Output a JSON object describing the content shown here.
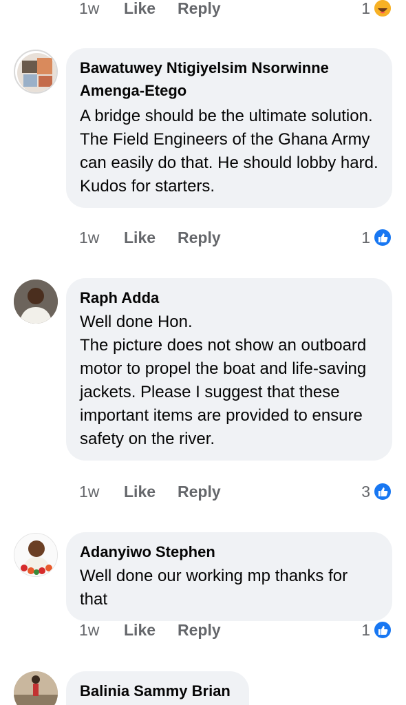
{
  "top_meta": {
    "time": "1w",
    "like": "Like",
    "reply": "Reply",
    "count": "1",
    "reaction": "haha-icon"
  },
  "comments": [
    {
      "author": "Bawatuwey Ntigiyelsim Nsorwinne Amenga-Etego",
      "text": "A bridge should be the ultimate solution. The Field Engineers of the Ghana Army can easily do that. He should lobby hard. Kudos for starters.",
      "time": "1w",
      "like": "Like",
      "reply": "Reply",
      "count": "1",
      "reaction": "like-icon"
    },
    {
      "author": "Raph Adda",
      "text": "Well done Hon.\nThe picture does not show an outboard motor to propel the boat and life-saving jackets. Please I suggest that these important items are provided to ensure safety on the river.",
      "time": "1w",
      "like": "Like",
      "reply": "Reply",
      "count": "3",
      "reaction": "like-icon"
    },
    {
      "author": "Adanyiwo Stephen",
      "text": "Well done our working mp thanks for that",
      "time": "1w",
      "like": "Like",
      "reply": "Reply",
      "count": "1",
      "reaction": "like-icon"
    },
    {
      "author": "Balinia Sammy Brian"
    }
  ],
  "colors": {
    "bubble": "#f0f2f5",
    "meta_text": "#65676b",
    "like_blue": "#1877f2",
    "haha_yellow": "#f7b125"
  }
}
